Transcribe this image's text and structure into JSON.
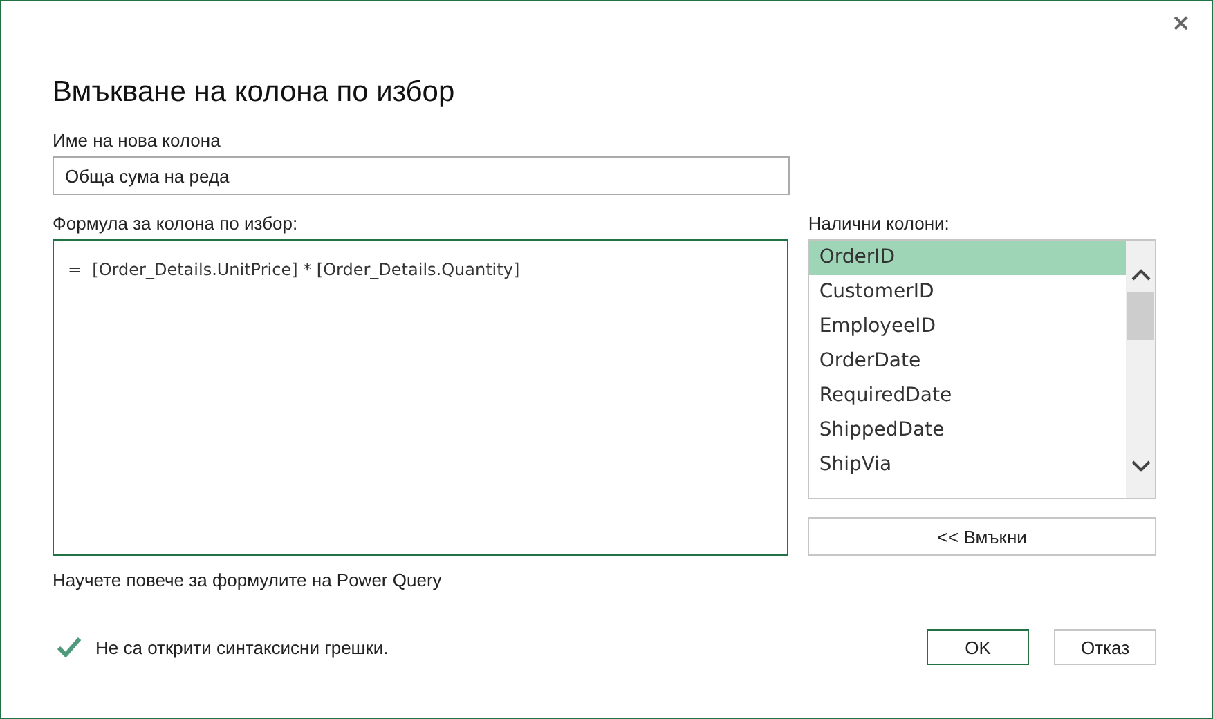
{
  "window": {
    "title": "Вмъкване на колона по избор",
    "close": "×"
  },
  "name_field": {
    "label": "Име на нова колона",
    "value": "Обща сума на реда"
  },
  "formula": {
    "label": "Формула за колона по избор:",
    "value": "=  [Order_Details.UnitPrice] * [Order_Details.Quantity]"
  },
  "available_columns": {
    "label": "Налични колони:",
    "items": [
      {
        "label": "OrderID",
        "selected": true
      },
      {
        "label": "CustomerID",
        "selected": false
      },
      {
        "label": "EmployeeID",
        "selected": false
      },
      {
        "label": "OrderDate",
        "selected": false
      },
      {
        "label": "RequiredDate",
        "selected": false
      },
      {
        "label": "ShippedDate",
        "selected": false
      },
      {
        "label": "ShipVia",
        "selected": false
      }
    ],
    "insert_button": "<< Вмъкни"
  },
  "help_link": "Научете повече за формулите на Power Query",
  "status": {
    "ok": true,
    "message": "Не са открити синтаксисни грешки."
  },
  "buttons": [
    {
      "label": "OK",
      "kind": "primary"
    },
    {
      "label": "Отказ",
      "kind": "secondary"
    }
  ]
}
